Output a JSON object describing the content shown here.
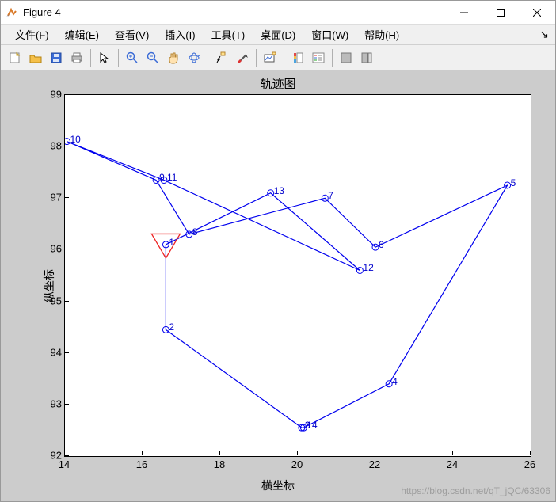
{
  "window": {
    "title": "Figure 4"
  },
  "menu": {
    "file": "文件(F)",
    "edit": "编辑(E)",
    "view": "查看(V)",
    "insert": "插入(I)",
    "tools": "工具(T)",
    "desktop": "桌面(D)",
    "window": "窗口(W)",
    "help": "帮助(H)"
  },
  "chart_data": {
    "type": "line",
    "title": "轨迹图",
    "xlabel": "横坐标",
    "ylabel": "纵坐标",
    "xlim": [
      14,
      26
    ],
    "ylim": [
      92,
      99
    ],
    "xticks": [
      14,
      16,
      18,
      20,
      22,
      24,
      26
    ],
    "yticks": [
      92,
      93,
      94,
      95,
      96,
      97,
      98,
      99
    ],
    "points": [
      {
        "n": 1,
        "x": 16.6,
        "y": 96.1
      },
      {
        "n": 2,
        "x": 16.6,
        "y": 94.45
      },
      {
        "n": 3,
        "x": 20.1,
        "y": 92.55
      },
      {
        "n": 14,
        "x": 20.15,
        "y": 92.55
      },
      {
        "n": 4,
        "x": 22.35,
        "y": 93.4
      },
      {
        "n": 5,
        "x": 25.4,
        "y": 97.25
      },
      {
        "n": 6,
        "x": 22.0,
        "y": 96.05
      },
      {
        "n": 7,
        "x": 20.7,
        "y": 97.0
      },
      {
        "n": 8,
        "x": 17.2,
        "y": 96.3
      },
      {
        "n": 9,
        "x": 16.35,
        "y": 97.35
      },
      {
        "n": 10,
        "x": 14.05,
        "y": 98.1
      },
      {
        "n": 11,
        "x": 16.55,
        "y": 97.35
      },
      {
        "n": 12,
        "x": 21.6,
        "y": 95.6
      },
      {
        "n": 13,
        "x": 19.3,
        "y": 97.1
      }
    ],
    "path_order": [
      1,
      2,
      3,
      14,
      4,
      5,
      6,
      7,
      8,
      9,
      10,
      11,
      12,
      13,
      1
    ],
    "start_marker": "red-triangle"
  },
  "watermark": "https://blog.csdn.net/qT_jQC/63306"
}
